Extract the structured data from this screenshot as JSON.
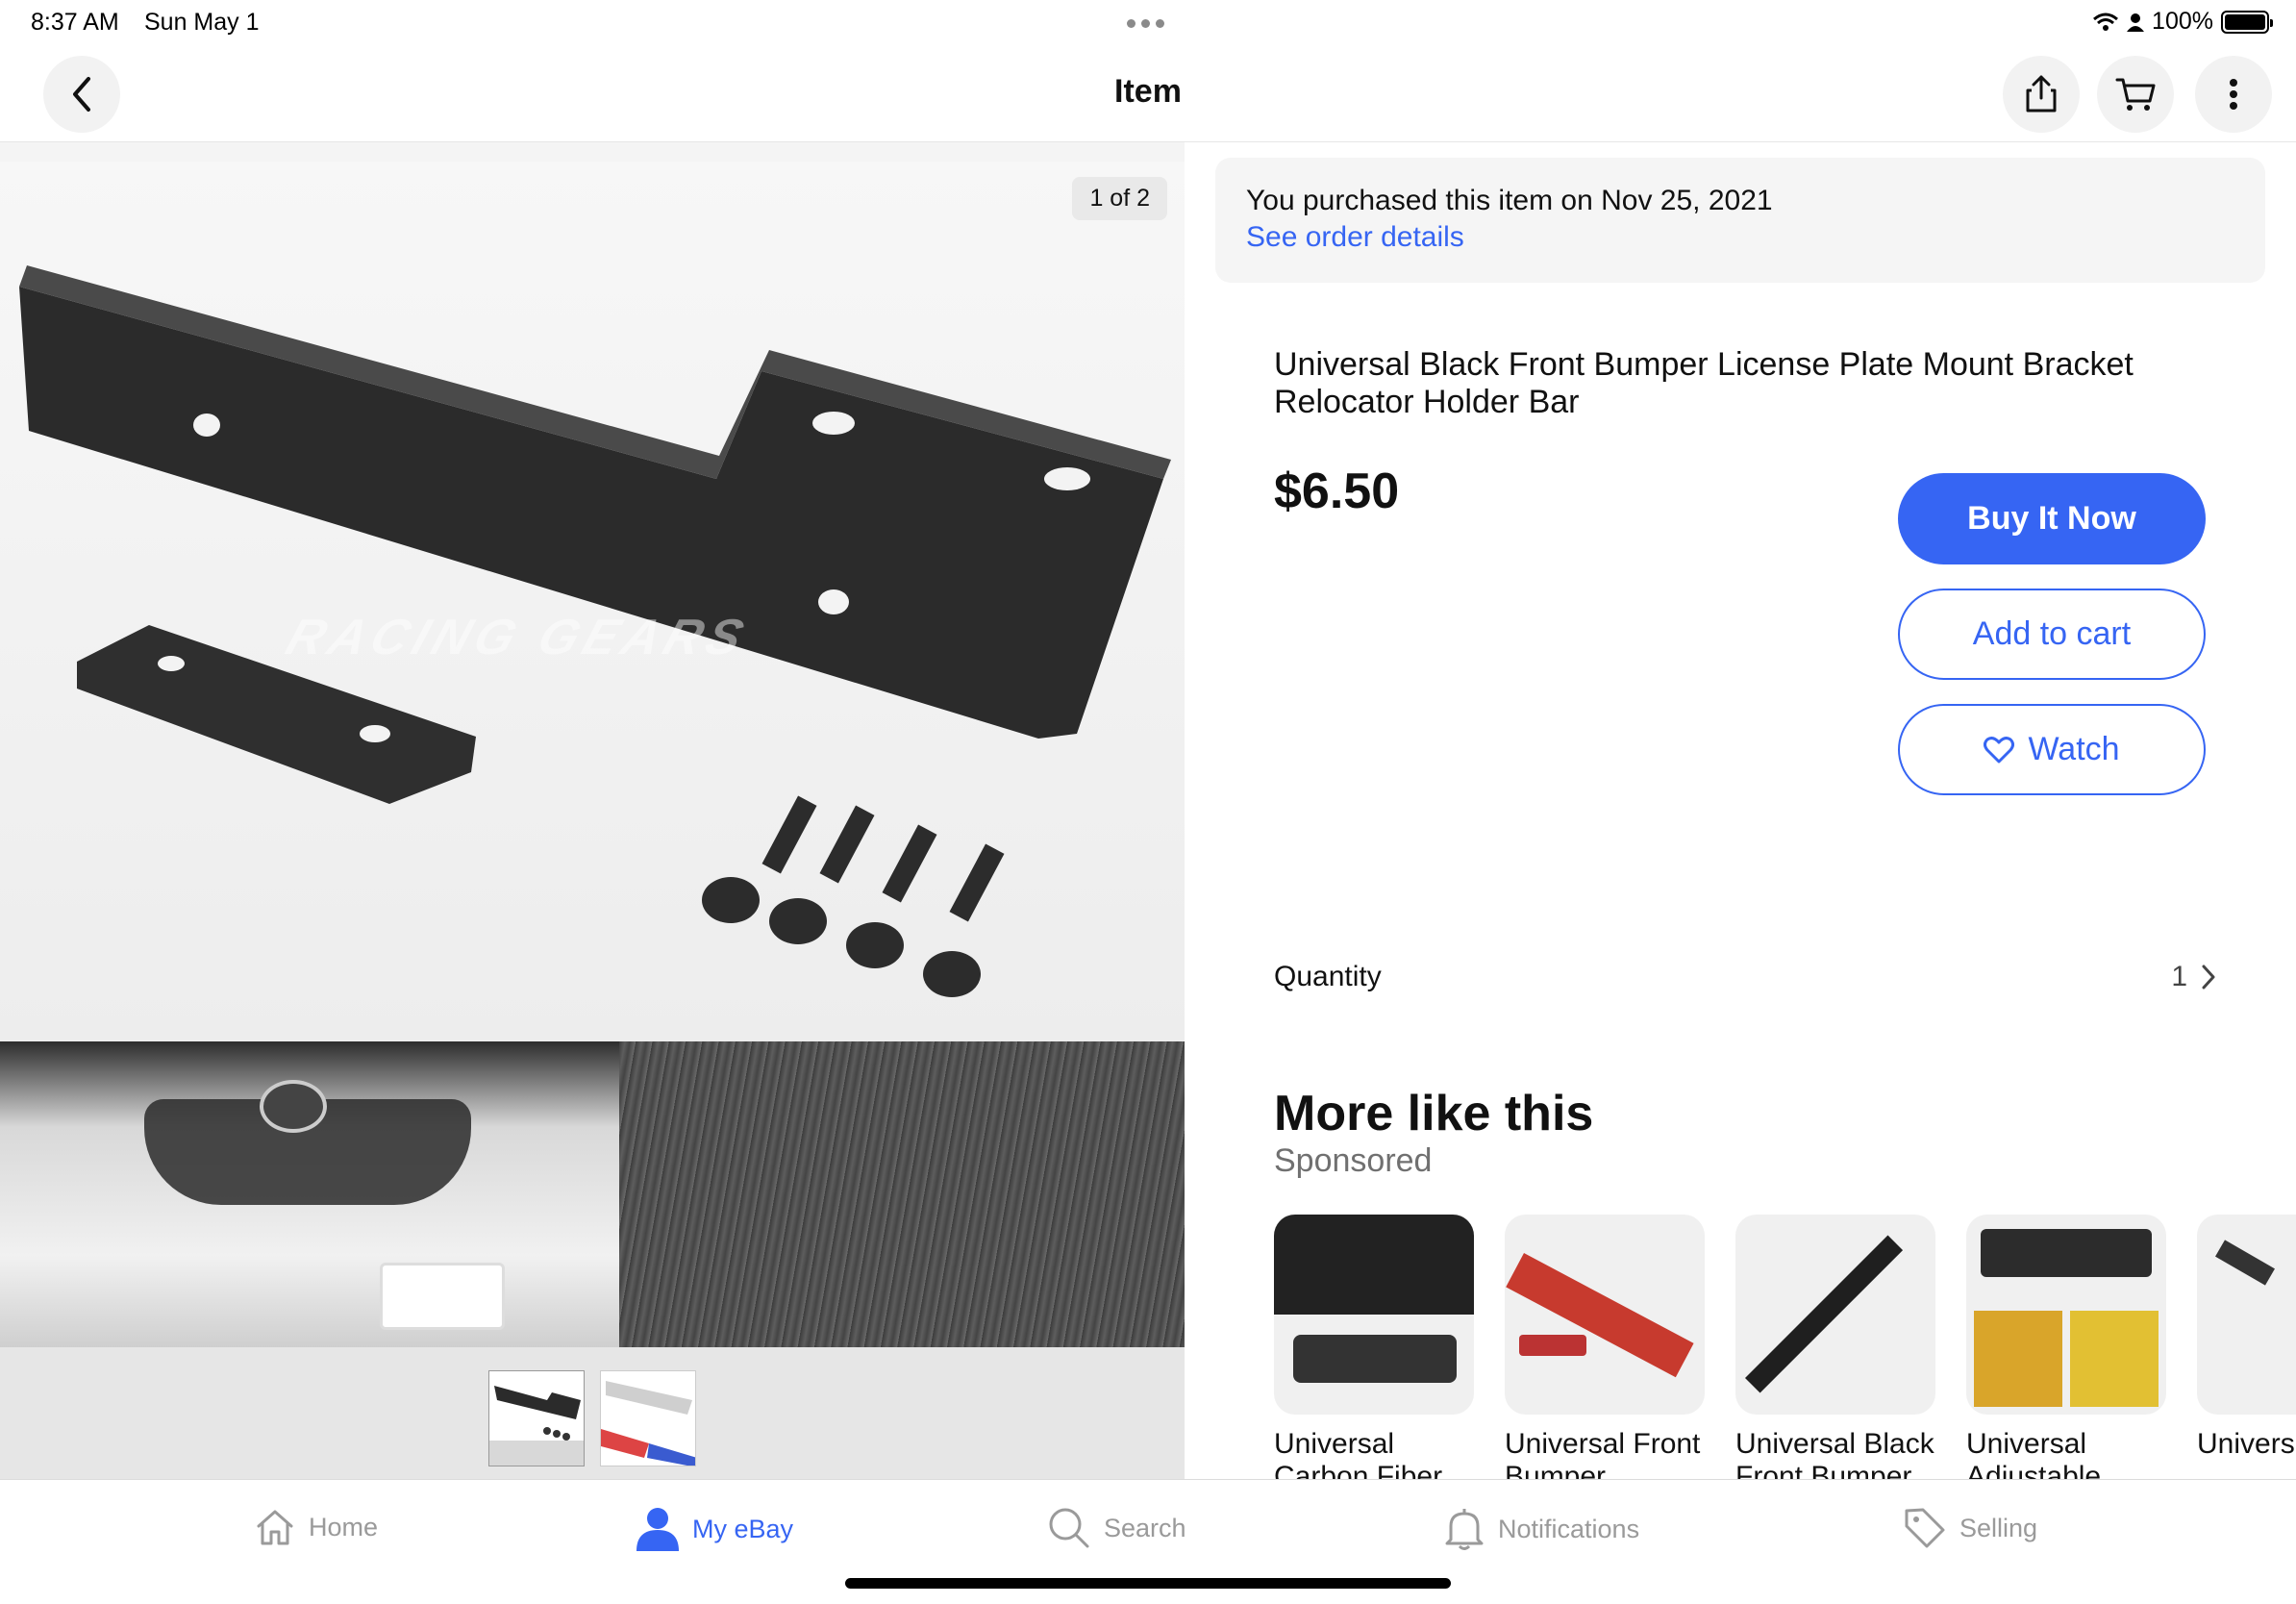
{
  "status": {
    "time": "8:37 AM",
    "date": "Sun May 1",
    "battery": "100%"
  },
  "nav": {
    "title": "Item",
    "back_icon": "chevron-left-icon",
    "share_icon": "share-icon",
    "cart_icon": "cart-icon",
    "more_icon": "more-vertical-icon"
  },
  "gallery": {
    "counter": "1 of 2",
    "watermark": "RACING GEARS"
  },
  "purchase": {
    "text": "You purchased this item on Nov 25, 2021",
    "link": "See order details"
  },
  "item": {
    "title": "Universal Black Front Bumper License Plate Mount Bracket Relocator Holder Bar",
    "price": "$6.50"
  },
  "actions": {
    "buy_now": "Buy It Now",
    "add_to_cart": "Add to cart",
    "watch": "Watch"
  },
  "quantity": {
    "label": "Quantity",
    "value": "1"
  },
  "more_like_this": {
    "title": "More like this",
    "sponsored": "Sponsored",
    "items": [
      {
        "title": "Universal Carbon Fiber"
      },
      {
        "title": "Universal Front Bumper"
      },
      {
        "title": "Universal Black Front Bumper"
      },
      {
        "title": "Universal Adjustable"
      },
      {
        "title": "Universal Front"
      }
    ]
  },
  "tabs": [
    {
      "label": "Home",
      "icon": "home-icon",
      "active": false
    },
    {
      "label": "My eBay",
      "icon": "user-icon",
      "active": true
    },
    {
      "label": "Search",
      "icon": "search-icon",
      "active": false
    },
    {
      "label": "Notifications",
      "icon": "bell-icon",
      "active": false
    },
    {
      "label": "Selling",
      "icon": "tag-icon",
      "active": false
    }
  ],
  "colors": {
    "accent": "#3665f3",
    "text": "#111111",
    "muted": "#707070"
  }
}
